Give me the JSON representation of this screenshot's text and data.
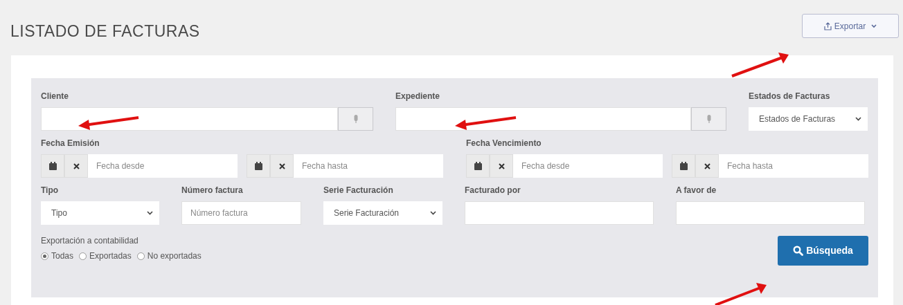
{
  "title": "LISTADO DE FACTURAS",
  "export_button": {
    "label": "Exportar"
  },
  "filter_rows": [
    [
      {
        "kind": "lookup",
        "label": "Cliente"
      },
      {
        "kind": "lookup",
        "label": "Expediente"
      },
      {
        "kind": "select",
        "label": "Estados de Facturas",
        "value": "Estados de Facturas"
      }
    ],
    [
      {
        "kind": "daterange",
        "label": "Fecha Emisión",
        "from_placeholder": "Fecha desde",
        "to_placeholder": "Fecha hasta"
      },
      {
        "kind": "daterange",
        "label": "Fecha Vencimiento",
        "from_placeholder": "Fecha desde",
        "to_placeholder": "Fecha hasta"
      }
    ],
    [
      {
        "kind": "select",
        "label": "Tipo",
        "value": "Tipo"
      },
      {
        "kind": "text",
        "label": "Número factura",
        "placeholder": "Número factura"
      },
      {
        "kind": "select",
        "label": "Serie Facturación",
        "value": "Serie Facturación"
      },
      {
        "kind": "text",
        "label": "Facturado por"
      },
      {
        "kind": "text",
        "label": "A favor de"
      }
    ]
  ],
  "export_filter": {
    "label": "Exportación a contabilidad",
    "options": [
      {
        "label": "Todas",
        "selected": true
      },
      {
        "label": "Exportadas",
        "selected": false
      },
      {
        "label": "No exportadas",
        "selected": false
      }
    ]
  },
  "search_button": {
    "label": "Búsqueda"
  }
}
